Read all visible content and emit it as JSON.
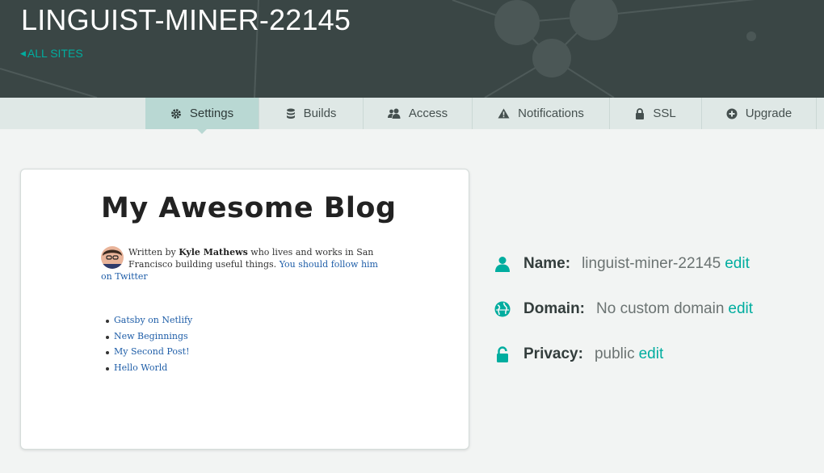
{
  "header": {
    "site_name": "LINGUIST-MINER-22145",
    "back_link": "ALL SITES"
  },
  "tabs": [
    {
      "label": "Settings",
      "icon": "gear-icon",
      "active": true
    },
    {
      "label": "Builds",
      "icon": "database-icon",
      "active": false
    },
    {
      "label": "Access",
      "icon": "users-icon",
      "active": false
    },
    {
      "label": "Notifications",
      "icon": "warning-icon",
      "active": false
    },
    {
      "label": "SSL",
      "icon": "lock-icon",
      "active": false
    },
    {
      "label": "Upgrade",
      "icon": "plus-circle-icon",
      "active": false
    }
  ],
  "preview": {
    "title": "My Awesome Blog",
    "bio_prefix": "Written by ",
    "author": "Kyle Mathews",
    "bio_middle": " who lives and works in San Francisco building useful things. ",
    "follow_link": "You should follow him on Twitter",
    "posts": [
      "Gatsby on Netlify",
      "New Beginnings",
      "My Second Post!",
      "Hello World"
    ]
  },
  "info": {
    "name": {
      "label": "Name:",
      "value": "linguist-miner-22145",
      "edit": "edit"
    },
    "domain": {
      "label": "Domain:",
      "value": "No custom domain",
      "edit": "edit"
    },
    "privacy": {
      "label": "Privacy:",
      "value": "public",
      "edit": "edit"
    }
  },
  "colors": {
    "accent": "#00ad9f",
    "header_bg": "#3a4645",
    "tab_active_bg": "#b9d8d3",
    "page_bg": "#f2f4f3"
  }
}
